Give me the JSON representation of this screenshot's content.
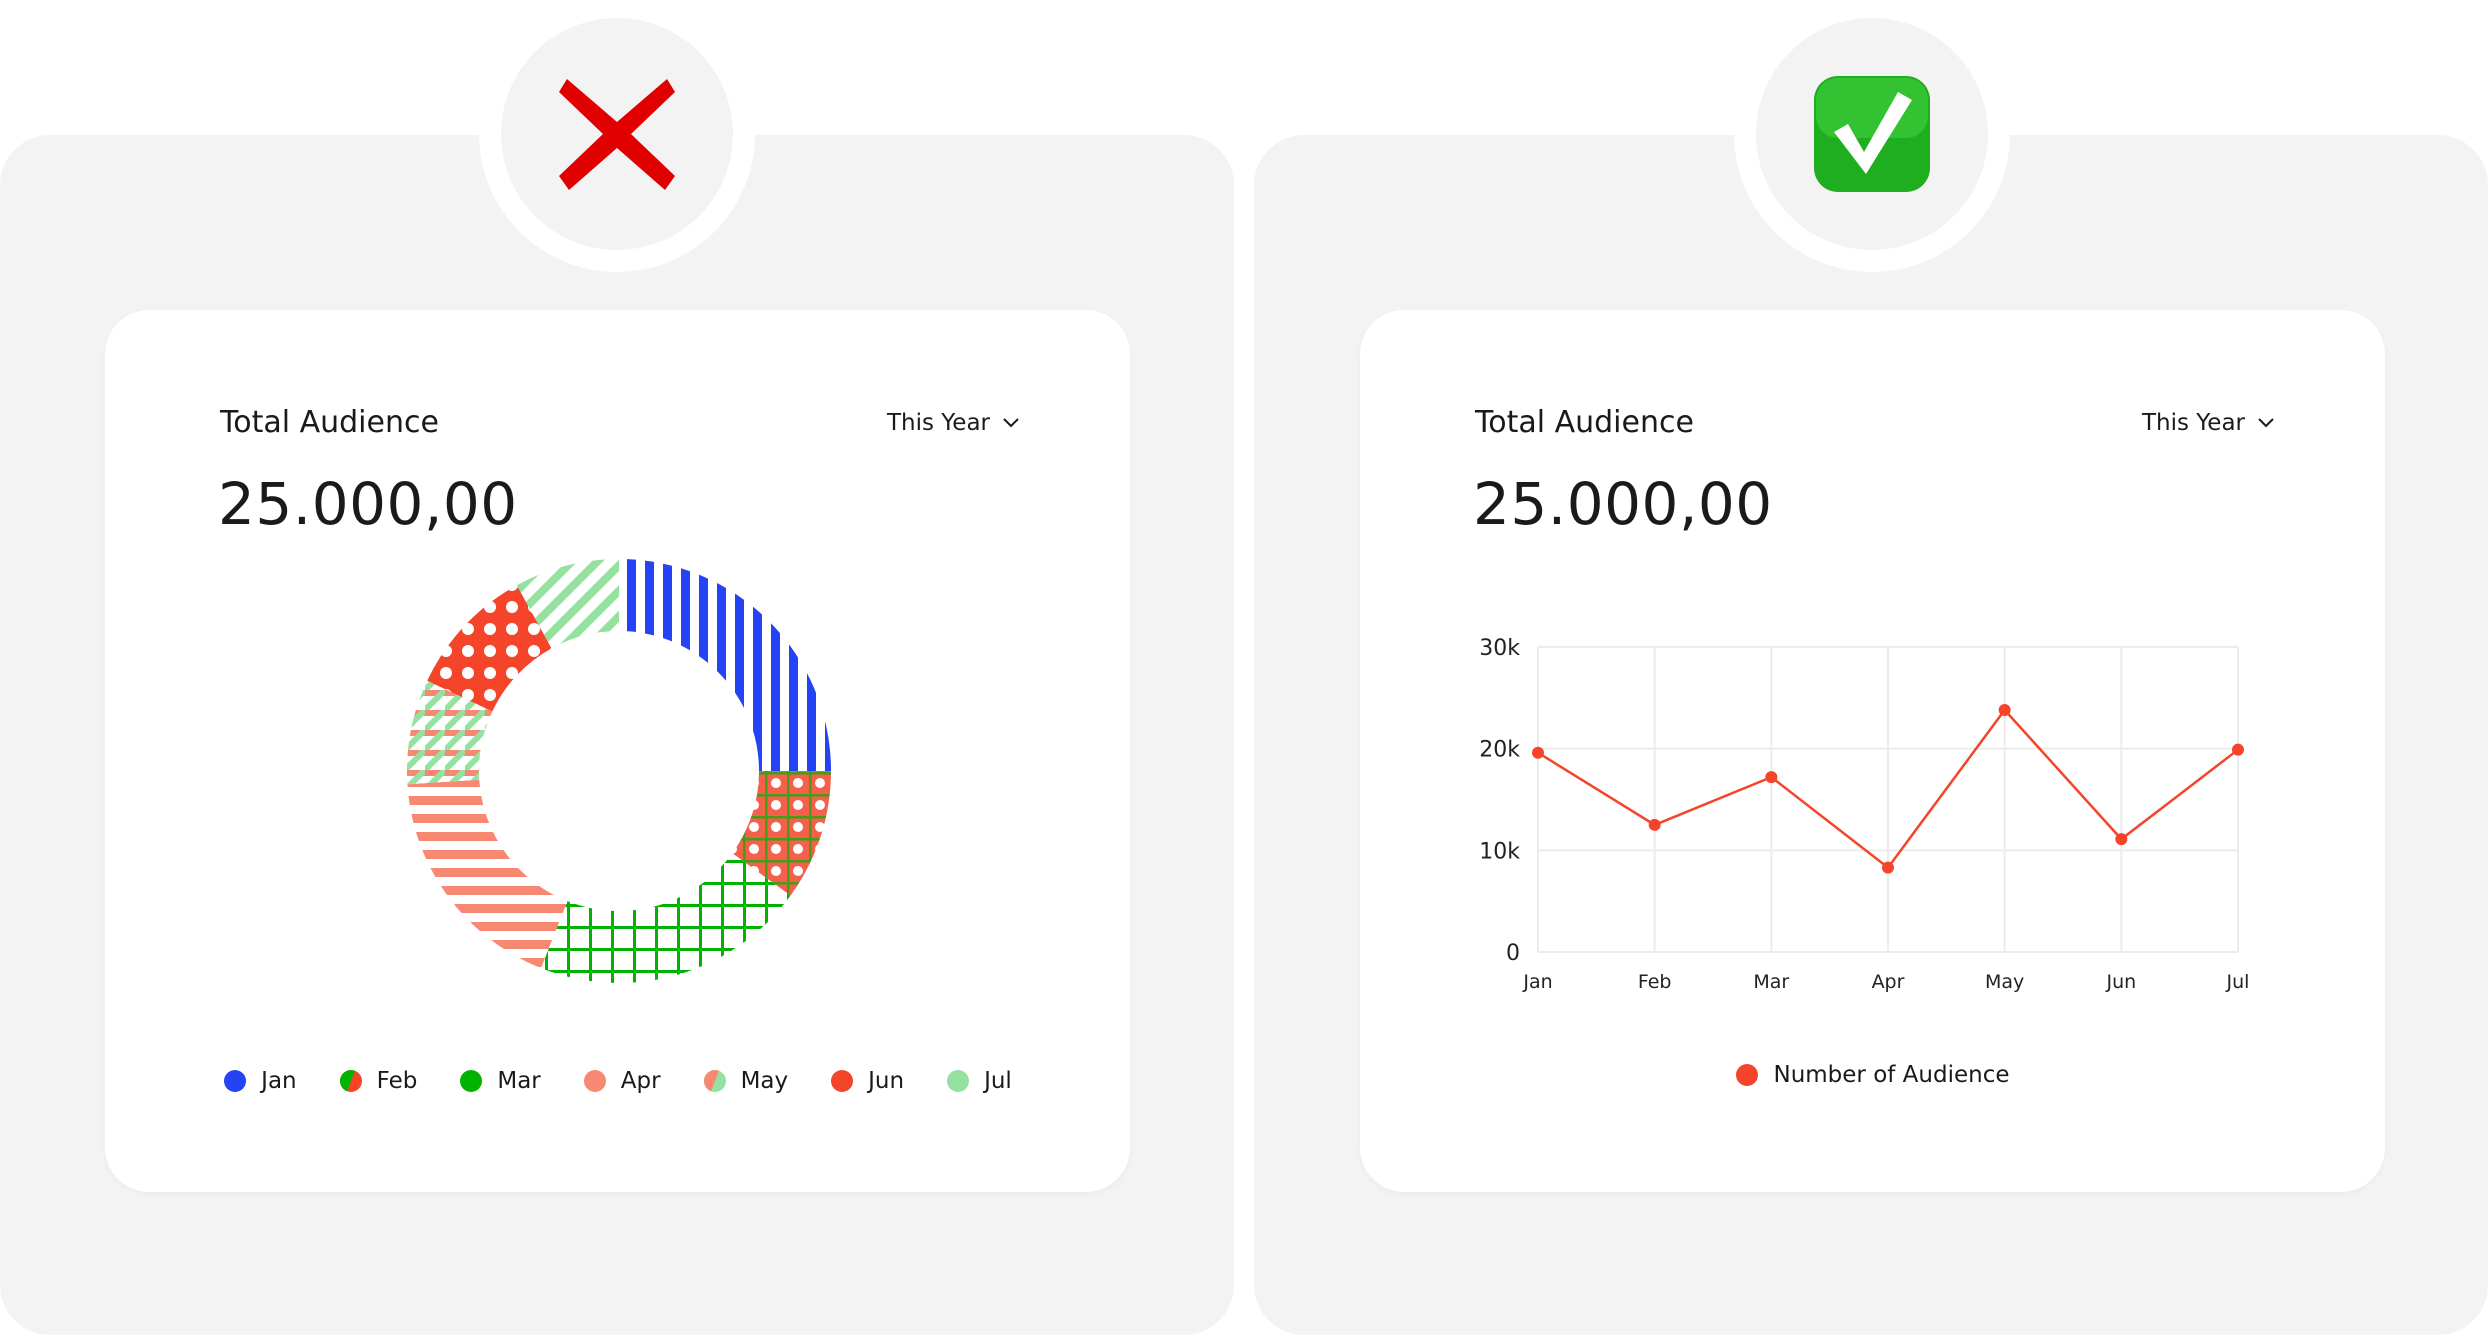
{
  "colors": {
    "jan": "#2343f5",
    "mar": "#00b300",
    "apr": "#f98873",
    "jun": "#f4442a",
    "jul": "#94e1a0",
    "line": "#f4442a",
    "grid": "#ececec"
  },
  "left": {
    "status_icon": "red-x-icon",
    "card": {
      "title": "Total Audience",
      "period": "This Year",
      "value": "25.000,00"
    }
  },
  "right": {
    "status_icon": "green-check-icon",
    "card": {
      "title": "Total Audience",
      "period": "This Year",
      "value": "25.000,00"
    }
  },
  "chart_data": [
    {
      "type": "pie",
      "style": "donut with pattern fills",
      "categories": [
        "Jan",
        "Feb",
        "Mar",
        "Apr",
        "May",
        "Jun",
        "Jul"
      ],
      "values": [
        25,
        10,
        21,
        18,
        8,
        10,
        8
      ],
      "legend": "bottom",
      "patterns": [
        "vertical-stripes",
        "dots-crosshatch",
        "grid",
        "horizontal-stripes",
        "diagonal-crosshatch",
        "dots",
        "diagonal-stripes"
      ]
    },
    {
      "type": "line",
      "x": [
        "Jan",
        "Feb",
        "Mar",
        "Apr",
        "May",
        "Jun",
        "Jul"
      ],
      "series": [
        {
          "name": "Number of Audience",
          "values": [
            19600,
            12500,
            17200,
            8300,
            23800,
            11100,
            19900
          ]
        }
      ],
      "yticks": [
        "0",
        "10k",
        "20k",
        "30k"
      ],
      "ylim": [
        0,
        30000
      ],
      "grid": true,
      "legend": "bottom"
    }
  ]
}
